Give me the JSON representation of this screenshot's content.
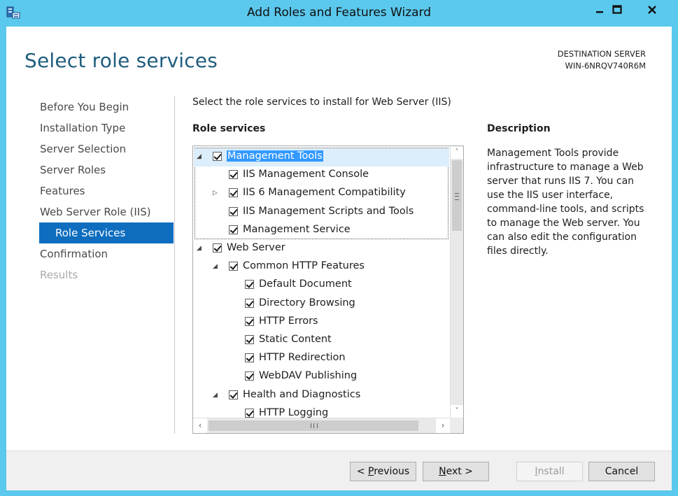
{
  "window": {
    "title": "Add Roles and Features Wizard",
    "icons": [
      "server-manager-icon",
      "minimize-icon",
      "maximize-icon",
      "close-icon"
    ],
    "accent_color": "#5bc8ed"
  },
  "header": {
    "page_title": "Select role services",
    "destination_label": "DESTINATION SERVER",
    "destination_server": "WIN-6NRQV740R6M"
  },
  "nav": {
    "items": [
      {
        "label": "Before You Begin",
        "state": "normal"
      },
      {
        "label": "Installation Type",
        "state": "normal"
      },
      {
        "label": "Server Selection",
        "state": "normal"
      },
      {
        "label": "Server Roles",
        "state": "normal"
      },
      {
        "label": "Features",
        "state": "normal"
      },
      {
        "label": "Web Server Role (IIS)",
        "state": "normal"
      },
      {
        "label": "Role Services",
        "state": "active"
      },
      {
        "label": "Confirmation",
        "state": "normal"
      },
      {
        "label": "Results",
        "state": "disabled"
      }
    ],
    "active_color": "#0e6dbf"
  },
  "main": {
    "instruction": "Select the role services to install for Web Server (IIS)",
    "role_services_label": "Role services",
    "description_label": "Description",
    "description_text": "Management Tools provide infrastructure to manage a Web server that runs IIS 7. You can use the IIS user interface, command-line tools, and scripts to manage the Web server. You can also edit the configuration files directly."
  },
  "tree": {
    "items": [
      {
        "label": "Management Tools",
        "level": 0,
        "expander": "expanded",
        "checked": true,
        "selected": true
      },
      {
        "label": "IIS Management Console",
        "level": 1,
        "expander": "none",
        "checked": true
      },
      {
        "label": "IIS 6 Management Compatibility",
        "level": 1,
        "expander": "collapsed",
        "checked": true
      },
      {
        "label": "IIS Management Scripts and Tools",
        "level": 1,
        "expander": "none",
        "checked": true
      },
      {
        "label": "Management Service",
        "level": 1,
        "expander": "none",
        "checked": true
      },
      {
        "label": "Web Server",
        "level": 0,
        "expander": "expanded",
        "checked": true
      },
      {
        "label": "Common HTTP Features",
        "level": 1,
        "expander": "expanded",
        "checked": true
      },
      {
        "label": "Default Document",
        "level": 2,
        "expander": "none",
        "checked": true
      },
      {
        "label": "Directory Browsing",
        "level": 2,
        "expander": "none",
        "checked": true
      },
      {
        "label": "HTTP Errors",
        "level": 2,
        "expander": "none",
        "checked": true
      },
      {
        "label": "Static Content",
        "level": 2,
        "expander": "none",
        "checked": true
      },
      {
        "label": "HTTP Redirection",
        "level": 2,
        "expander": "none",
        "checked": true
      },
      {
        "label": "WebDAV Publishing",
        "level": 2,
        "expander": "none",
        "checked": true
      },
      {
        "label": "Health and Diagnostics",
        "level": 1,
        "expander": "expanded",
        "checked": true
      },
      {
        "label": "HTTP Logging",
        "level": 2,
        "expander": "none",
        "checked": true
      }
    ],
    "selection_color": "#3399ff"
  },
  "footer": {
    "previous": {
      "prefix": "< ",
      "accel": "P",
      "rest": "revious"
    },
    "next": {
      "accel": "N",
      "rest": "ext >"
    },
    "install": {
      "accel": "I",
      "rest": "nstall",
      "enabled": false
    },
    "cancel": "Cancel"
  }
}
